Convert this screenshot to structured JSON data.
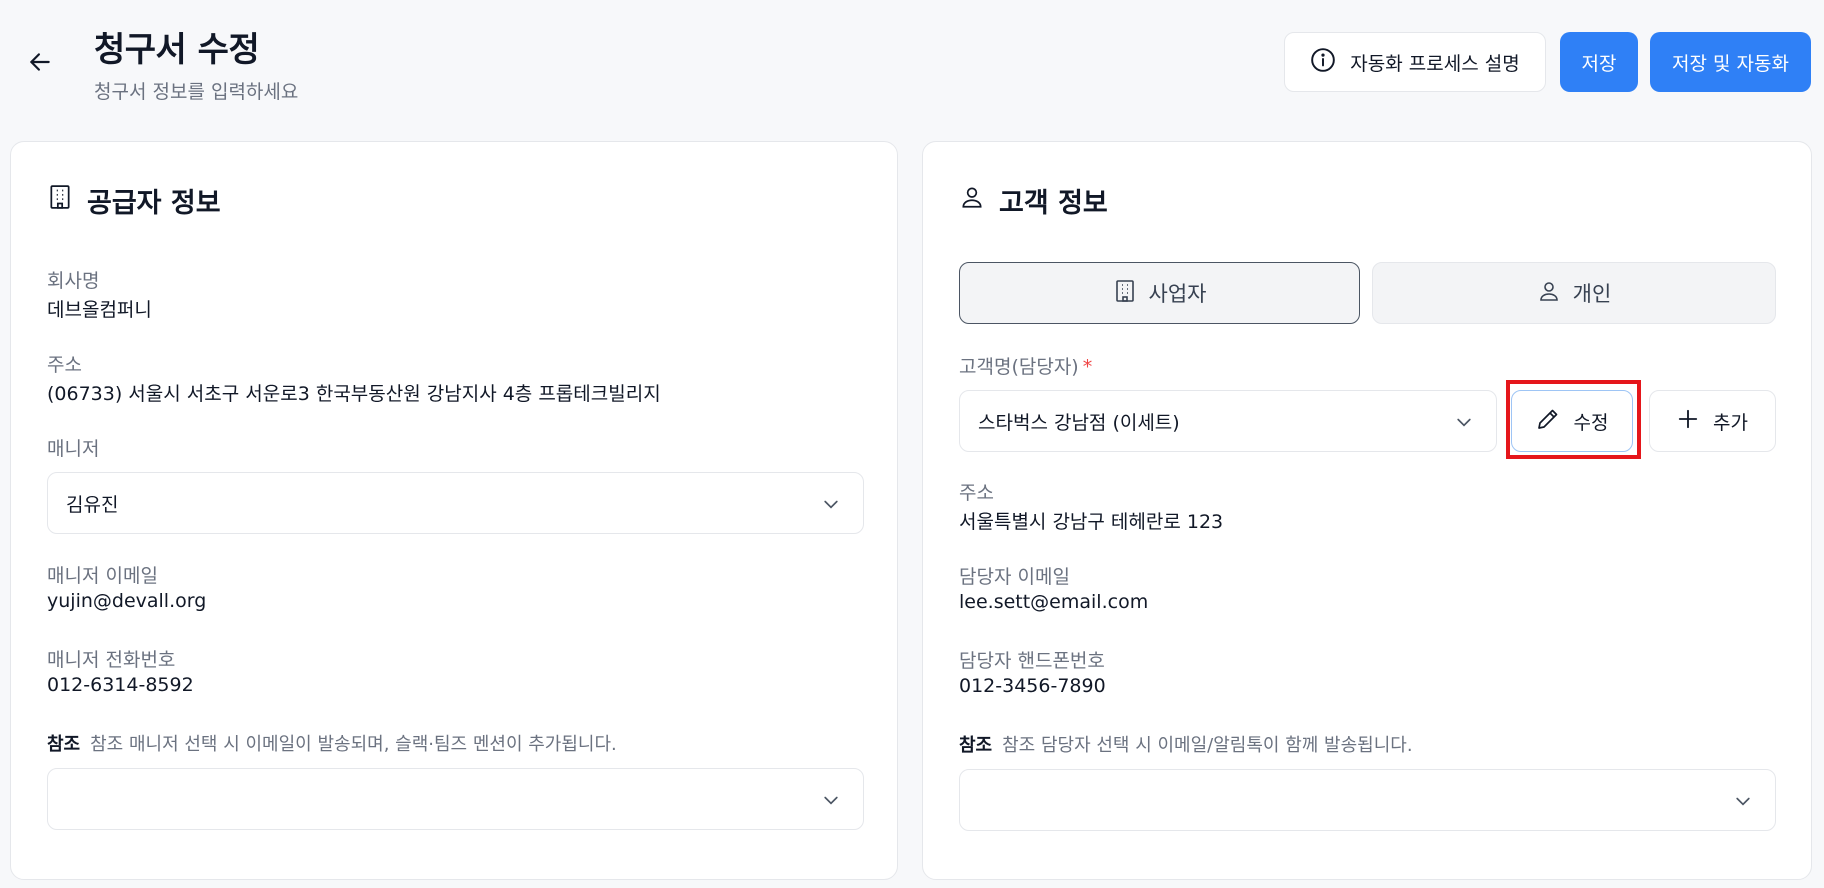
{
  "header": {
    "title": "청구서 수정",
    "subtitle": "청구서 정보를 입력하세요",
    "explain_label": "자동화 프로세스 설명",
    "save_label": "저장",
    "save_auto_label": "저장 및 자동화"
  },
  "supplier": {
    "title": "공급자 정보",
    "company_label": "회사명",
    "company_value": "데브올컴퍼니",
    "address_label": "주소",
    "address_value": "(06733) 서울시 서초구 서운로3 한국부동산원 강남지사 4층 프롭테크빌리지",
    "manager_label": "매니저",
    "manager_value": "김유진",
    "manager_email_label": "매니저 이메일",
    "manager_email_value": "yujin@devall.org",
    "manager_phone_label": "매니저 전화번호",
    "manager_phone_value": "012-6314-8592",
    "note_prefix": "참조",
    "note_text": "참조 매니저 선택 시 이메일이 발송되며, 슬랙·팀즈 멘션이 추가됩니다.",
    "cc_value": ""
  },
  "customer": {
    "title": "고객 정보",
    "tab_business": "사업자",
    "tab_personal": "개인",
    "name_label": "고객명(담당자)",
    "required_mark": "*",
    "name_value": "스타벅스 강남점 (이세트)",
    "edit_label": "수정",
    "add_label": "추가",
    "address_label": "주소",
    "address_value": "서울특별시 강남구 테헤란로 123",
    "email_label": "담당자 이메일",
    "email_value": "lee.sett@email.com",
    "phone_label": "담당자 핸드폰번호",
    "phone_value": "012-3456-7890",
    "note_prefix": "참조",
    "note_text": "참조 담당자 선택 시 이메일/알림톡이 함께 발송됩니다.",
    "cc_value": ""
  },
  "colors": {
    "primary": "#2f80f6",
    "highlight": "#e5161b",
    "required": "#ef4444"
  }
}
